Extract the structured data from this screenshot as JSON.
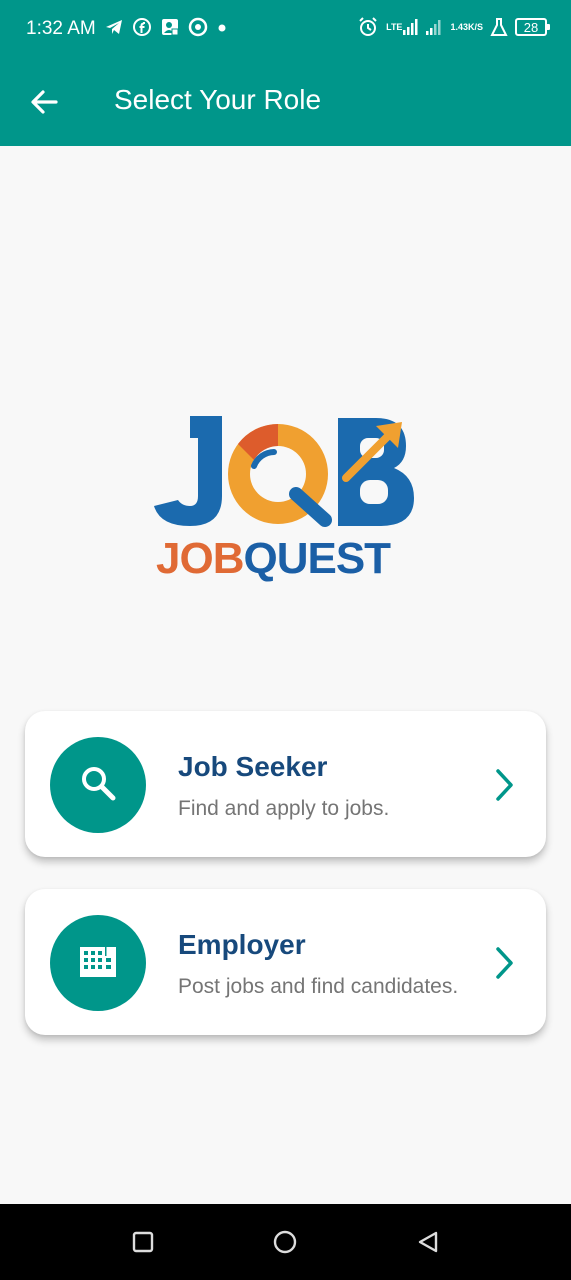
{
  "status_bar": {
    "time": "1:32 AM",
    "network_type": "LTE",
    "speed_value": "1.43",
    "speed_unit": "K/S",
    "battery_level": "28"
  },
  "app_bar": {
    "title": "Select Your Role",
    "back_icon": "arrow-left-icon"
  },
  "logo": {
    "mark_text": "JOB",
    "brand_job": "JOB",
    "brand_quest": "QUEST"
  },
  "roles": [
    {
      "title": "Job Seeker",
      "subtitle": "Find and apply to jobs.",
      "icon": "search-icon"
    },
    {
      "title": "Employer",
      "subtitle": "Post jobs and find candidates.",
      "icon": "building-icon"
    }
  ],
  "colors": {
    "primary": "#00968a",
    "title_blue": "#17497c",
    "subtitle_gray": "#757575",
    "logo_blue": "#1b6aae",
    "logo_orange": "#f0a030",
    "logo_red": "#d9502c"
  }
}
